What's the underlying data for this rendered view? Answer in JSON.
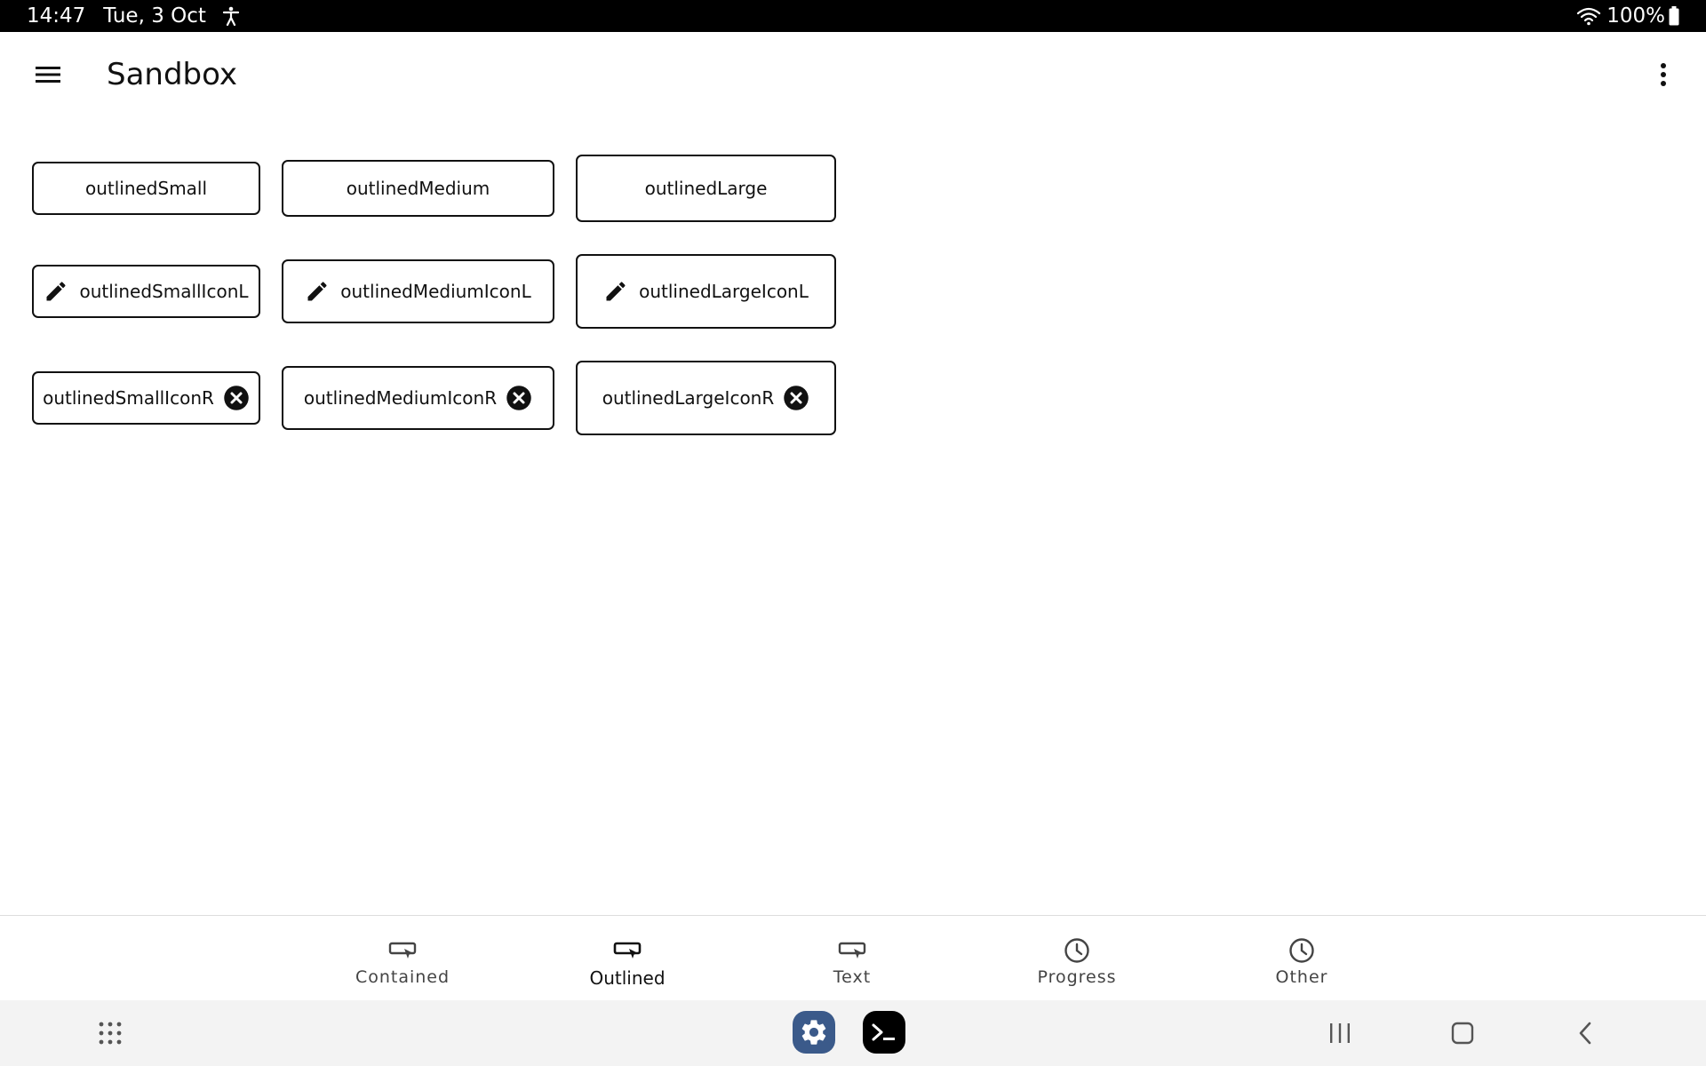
{
  "status_bar": {
    "time": "14:47",
    "date": "Tue, 3 Oct",
    "battery": "100%"
  },
  "app_bar": {
    "title": "Sandbox"
  },
  "buttons": {
    "outlined_small": "outlinedSmall",
    "outlined_medium": "outlinedMedium",
    "outlined_large": "outlinedLarge",
    "outlined_small_icon_l": "outlinedSmallIconL",
    "outlined_medium_icon_l": "outlinedMediumIconL",
    "outlined_large_icon_l": "outlinedLargeIconL",
    "outlined_small_icon_r": "outlinedSmallIconR",
    "outlined_medium_icon_r": "outlinedMediumIconR",
    "outlined_large_icon_r": "outlinedLargeIconR"
  },
  "bottom_nav": {
    "items": [
      {
        "label": "Contained",
        "icon": "button-icon"
      },
      {
        "label": "Outlined",
        "icon": "button-icon",
        "active": true
      },
      {
        "label": "Text",
        "icon": "button-icon"
      },
      {
        "label": "Progress",
        "icon": "clock-icon"
      },
      {
        "label": "Other",
        "icon": "clock-icon"
      }
    ]
  },
  "colors": {
    "status_bar_bg": "#000000",
    "outline": "#111111",
    "settings_app_bg": "#3b5a8a",
    "terminal_app_bg": "#000000"
  }
}
